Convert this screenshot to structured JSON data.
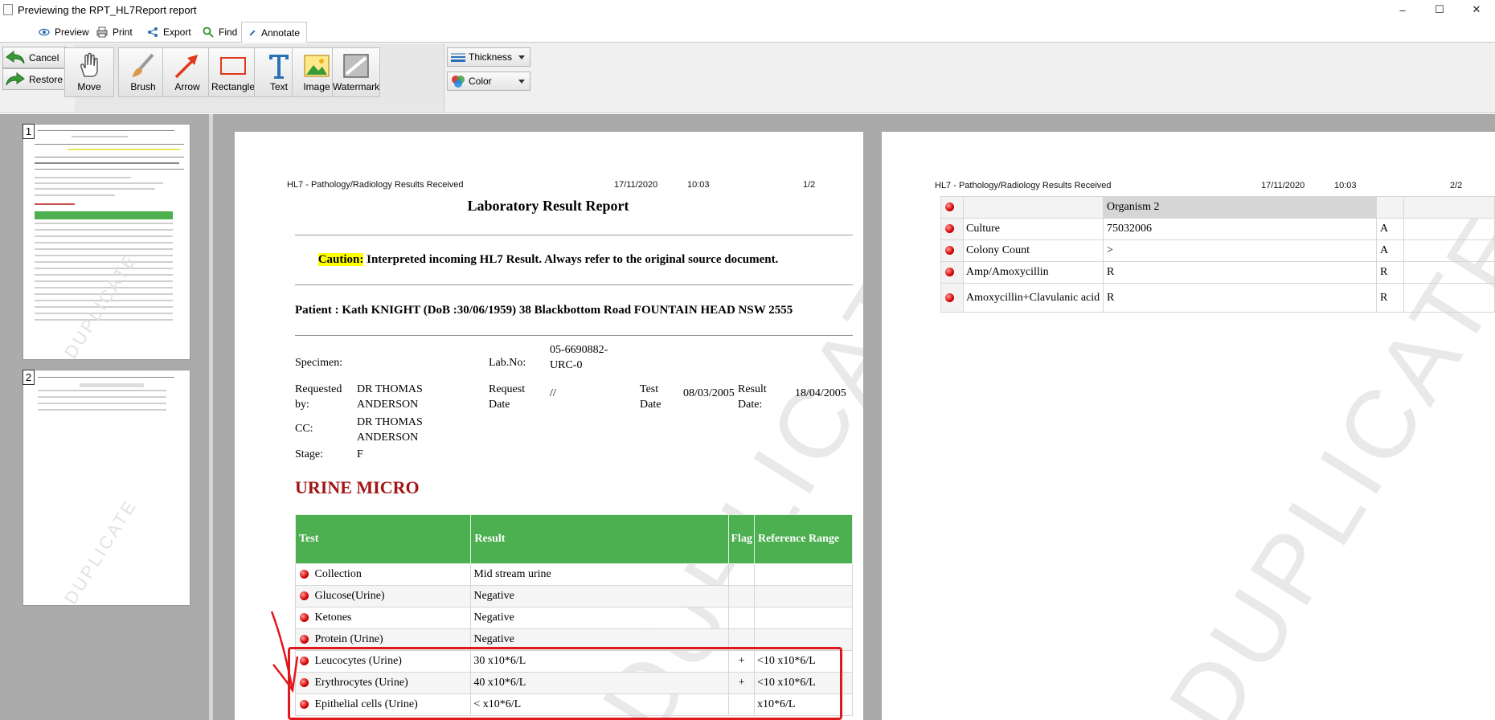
{
  "window": {
    "title": "Previewing the RPT_HL7Report report",
    "minimize": "–",
    "maximize": "☐",
    "close": "✕"
  },
  "tabs": [
    {
      "label": "Preview",
      "icon": "eye-icon"
    },
    {
      "label": "Print",
      "icon": "printer-icon"
    },
    {
      "label": "Export",
      "icon": "share-icon"
    },
    {
      "label": "Find",
      "icon": "magnifier-icon"
    },
    {
      "label": "Annotate",
      "icon": "pen-icon"
    }
  ],
  "ribbon": {
    "cancel": "Cancel",
    "restore": "Restore",
    "tools": [
      "Move",
      "Brush",
      "Arrow",
      "Rectangle",
      "Text",
      "Image",
      "Watermark"
    ],
    "thickness": "Thickness",
    "color": "Color"
  },
  "thumbnails": {
    "page1_num": "1",
    "page2_num": "2",
    "watermark": "DUPLICATE"
  },
  "page1": {
    "header_left": "HL7 - Pathology/Radiology Results Received",
    "header_date": "17/11/2020",
    "header_time": "10:03",
    "header_page": "1/2",
    "title": "Laboratory Result Report",
    "caution_label": "Caution:",
    "caution_text": "Interpreted incoming HL7 Result. Always refer to the original source document.",
    "patient_line": "Patient : Kath KNIGHT (DoB :30/06/1959) 38 Blackbottom Road FOUNTAIN HEAD NSW 2555",
    "specimen_label": "Specimen:",
    "labno_label": "Lab.No:",
    "labno_value": "05-6690882-URC-0",
    "requested_by_label": "Requested by:",
    "requested_by_value": "DR THOMAS ANDERSON",
    "request_date_label": "Request Date",
    "request_date_value": "//",
    "test_date_label": "Test Date",
    "test_date_value": "08/03/2005",
    "result_date_label": "Result Date:",
    "result_date_value": "18/04/2005",
    "cc_label": "CC:",
    "cc_value": "DR THOMAS ANDERSON",
    "stage_label": "Stage:",
    "stage_value": "F",
    "section_title": "URINE MICRO",
    "watermark": "DUPLICATE",
    "table_headers": {
      "test": "Test",
      "result": "Result",
      "flag": "Flag",
      "range": "Reference Range"
    },
    "rows": [
      {
        "test": "Collection",
        "result": "Mid stream urine",
        "flag": "",
        "range": ""
      },
      {
        "test": "Glucose(Urine)",
        "result": "Negative",
        "flag": "",
        "range": ""
      },
      {
        "test": "Ketones",
        "result": "Negative",
        "flag": "",
        "range": ""
      },
      {
        "test": "Protein (Urine)",
        "result": "Negative",
        "flag": "",
        "range": ""
      },
      {
        "test": "Leucocytes (Urine)",
        "result": "30 x10*6/L",
        "flag": "+",
        "range": "<10 x10*6/L"
      },
      {
        "test": "Erythrocytes (Urine)",
        "result": "40 x10*6/L",
        "flag": "+",
        "range": "<10 x10*6/L"
      },
      {
        "test": "Epithelial cells (Urine)",
        "result": "< x10*6/L",
        "flag": "",
        "range": "x10*6/L"
      }
    ]
  },
  "page2": {
    "header_left": "HL7 - Pathology/Radiology Results Received",
    "header_date": "17/11/2020",
    "header_time": "10:03",
    "header_page": "2/2",
    "watermark": "DUPLICATE",
    "organism_header": "Organism 2",
    "rows": [
      {
        "name": "Culture",
        "value": "75032006",
        "flag": "A"
      },
      {
        "name": "Colony Count",
        "value": ">",
        "flag": "A"
      },
      {
        "name": "Amp/Amoxycillin",
        "value": "R",
        "flag": "R"
      },
      {
        "name": "Amoxycillin+Clavulanic acid",
        "value": "R",
        "flag": "R"
      }
    ]
  },
  "colors": {
    "accent_green": "#4caf50",
    "section_red": "#a31515",
    "annotation_red": "#e0181b",
    "caution_highlight": "#ffff00"
  }
}
